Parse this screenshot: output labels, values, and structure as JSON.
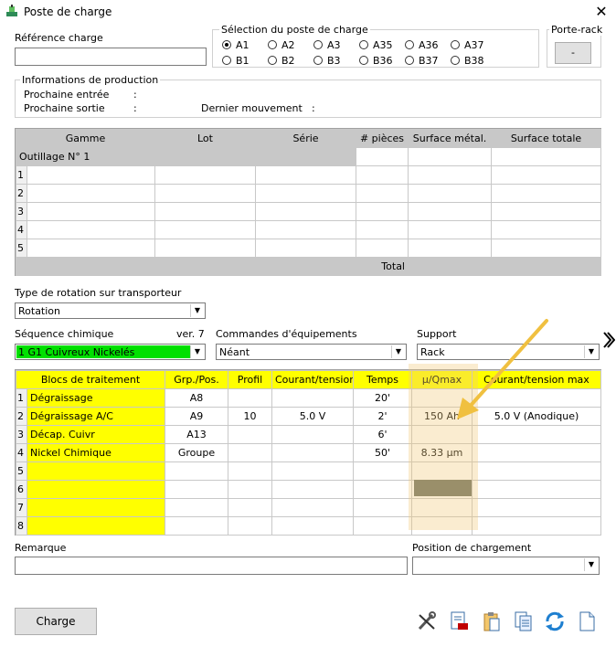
{
  "window": {
    "title": "Poste de charge",
    "close": "✕"
  },
  "reference": {
    "label": "Référence charge",
    "value": ""
  },
  "selection": {
    "label": "Sélection du poste de charge",
    "row1": [
      "A1",
      "A2",
      "A3",
      "A35",
      "A36",
      "A37"
    ],
    "row2": [
      "B1",
      "B2",
      "B3",
      "B36",
      "B37",
      "B38"
    ],
    "selected": "A1"
  },
  "porte_rack": {
    "label": "Porte-rack",
    "button": "-"
  },
  "production": {
    "label": "Informations de production",
    "next_in": "Prochaine entrée",
    "next_out": "Prochaine sortie",
    "last_move": "Dernier mouvement",
    "colon": ":"
  },
  "outillage_table": {
    "headers": [
      "Gamme",
      "Lot",
      "Série",
      "# pièces",
      "Surface métal.",
      "Surface totale"
    ],
    "group": "Outillage N° 1",
    "rows": [
      "1",
      "2",
      "3",
      "4",
      "5"
    ],
    "total": "Total"
  },
  "rotation": {
    "label": "Type de rotation sur transporteur",
    "value": "Rotation"
  },
  "sequence": {
    "label": "Séquence chimique",
    "version": "ver. 7",
    "value": "1 G1 Cuivreux Nickelés",
    "color": "#00e000"
  },
  "commandes": {
    "label": "Commandes d'équipements",
    "value": "Néant"
  },
  "support": {
    "label": "Support",
    "value": "Rack"
  },
  "blocs_table": {
    "headers": [
      "Blocs de traitement",
      "Grp./Pos.",
      "Profil",
      "Courant/tension",
      "Temps",
      "μ/Qmax",
      "Courant/tension max"
    ],
    "rows": [
      {
        "n": "1",
        "bloc": "Dégraissage",
        "grp": "A8",
        "profil": "",
        "courant": "",
        "temps": "20'",
        "qmax": "",
        "max": ""
      },
      {
        "n": "2",
        "bloc": "Dégraissage A/C",
        "grp": "A9",
        "profil": "10",
        "courant": "5.0 V",
        "temps": "2'",
        "qmax": "150 Ah",
        "max": "5.0 V (Anodique)"
      },
      {
        "n": "3",
        "bloc": "Décap. Cuivr",
        "grp": "A13",
        "profil": "",
        "courant": "",
        "temps": "6'",
        "qmax": "",
        "max": ""
      },
      {
        "n": "4",
        "bloc": "Nickel Chimique",
        "grp": "Groupe",
        "profil": "",
        "courant": "",
        "temps": "50'",
        "qmax": "8.33 µm",
        "max": ""
      },
      {
        "n": "5",
        "bloc": "",
        "grp": "",
        "profil": "",
        "courant": "",
        "temps": "",
        "qmax": "",
        "max": ""
      },
      {
        "n": "6",
        "bloc": "",
        "grp": "",
        "profil": "",
        "courant": "",
        "temps": "",
        "qmax": "",
        "max": ""
      },
      {
        "n": "7",
        "bloc": "",
        "grp": "",
        "profil": "",
        "courant": "",
        "temps": "",
        "qmax": "",
        "max": ""
      },
      {
        "n": "8",
        "bloc": "",
        "grp": "",
        "profil": "",
        "courant": "",
        "temps": "",
        "qmax": "",
        "max": ""
      }
    ]
  },
  "remarque": {
    "label": "Remarque",
    "value": ""
  },
  "position": {
    "label": "Position de chargement",
    "value": ""
  },
  "charge_button": "Charge",
  "toolbar_icons": [
    "tools-icon",
    "document-red-icon",
    "clipboard-icon",
    "copy-icon",
    "refresh-icon",
    "blank-page-icon"
  ]
}
